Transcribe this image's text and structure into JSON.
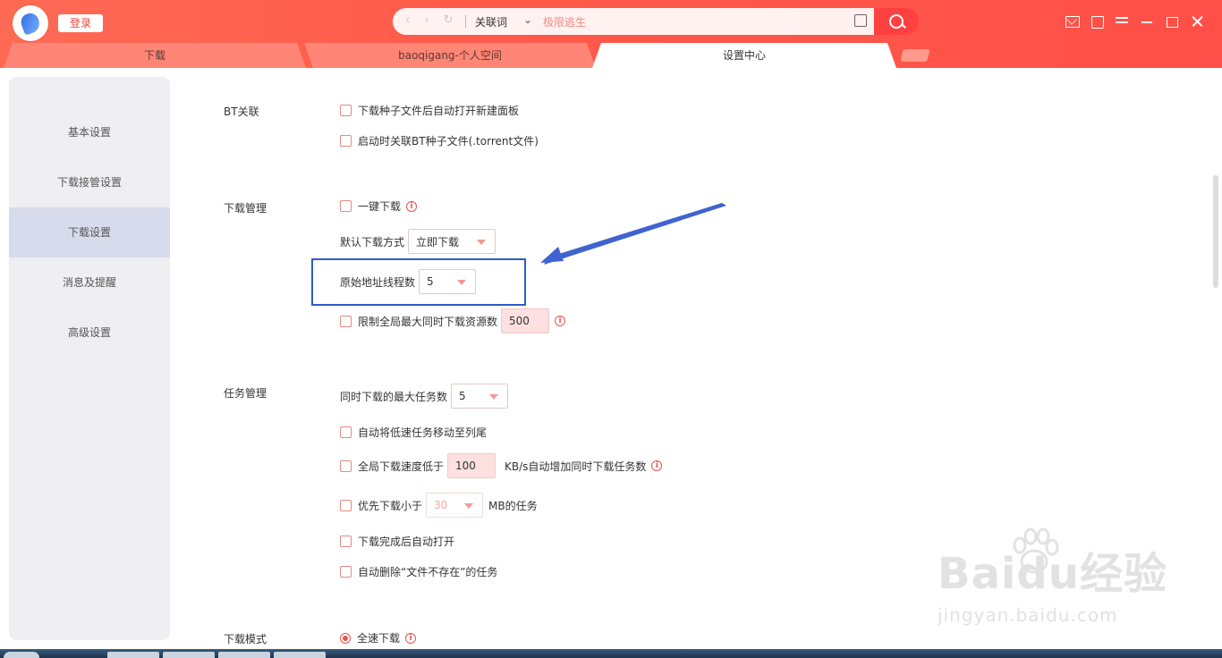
{
  "header": {
    "login_label": "登录",
    "search": {
      "association_label": "关联词",
      "query": "极限逃生"
    }
  },
  "tabs": [
    {
      "label": "下载",
      "active": false
    },
    {
      "label": "baoqigang-个人空间",
      "active": false
    },
    {
      "label": "设置中心",
      "active": true
    }
  ],
  "sidebar": {
    "items": [
      {
        "label": "基本设置",
        "active": false
      },
      {
        "label": "下载接管设置",
        "active": false
      },
      {
        "label": "下载设置",
        "active": true
      },
      {
        "label": "消息及提醒",
        "active": false
      },
      {
        "label": "高级设置",
        "active": false
      }
    ]
  },
  "sections": {
    "bt": {
      "title": "BT关联",
      "opt_auto_open": "下载种子文件后自动打开新建面板",
      "opt_assoc_torrent": "启动时关联BT种子文件(.torrent文件)"
    },
    "download_mgmt": {
      "title": "下载管理",
      "opt_one_click": "一键下载",
      "default_mode_label": "默认下载方式",
      "default_mode_value": "立即下载",
      "threads_label": "原始地址线程数",
      "threads_value": "5",
      "opt_limit_sources": "限制全局最大同时下载资源数",
      "limit_sources_value": "500"
    },
    "task_mgmt": {
      "title": "任务管理",
      "max_tasks_label": "同时下载的最大任务数",
      "max_tasks_value": "5",
      "opt_move_slow": "自动将低速任务移动至列尾",
      "opt_speed_prefix": "全局下载速度低于",
      "speed_value": "100",
      "opt_speed_suffix": "KB/s自动增加同时下载任务数",
      "opt_priority_prefix": "优先下载小于",
      "priority_value": "30",
      "opt_priority_suffix": "MB的任务",
      "opt_auto_open_done": "下载完成后自动打开",
      "opt_auto_delete": "自动删除“文件不存在”的任务"
    },
    "download_mode": {
      "title": "下载模式",
      "opt_full_speed": "全速下载"
    }
  },
  "watermark": {
    "main": "Baidu经验",
    "sub": "jingyan.baidu.com"
  },
  "colors": {
    "titlebar": "#ff5a4a",
    "highlight_box": "#2e5cc5",
    "arrow": "#3f63d0",
    "accent": "#e9544c"
  }
}
